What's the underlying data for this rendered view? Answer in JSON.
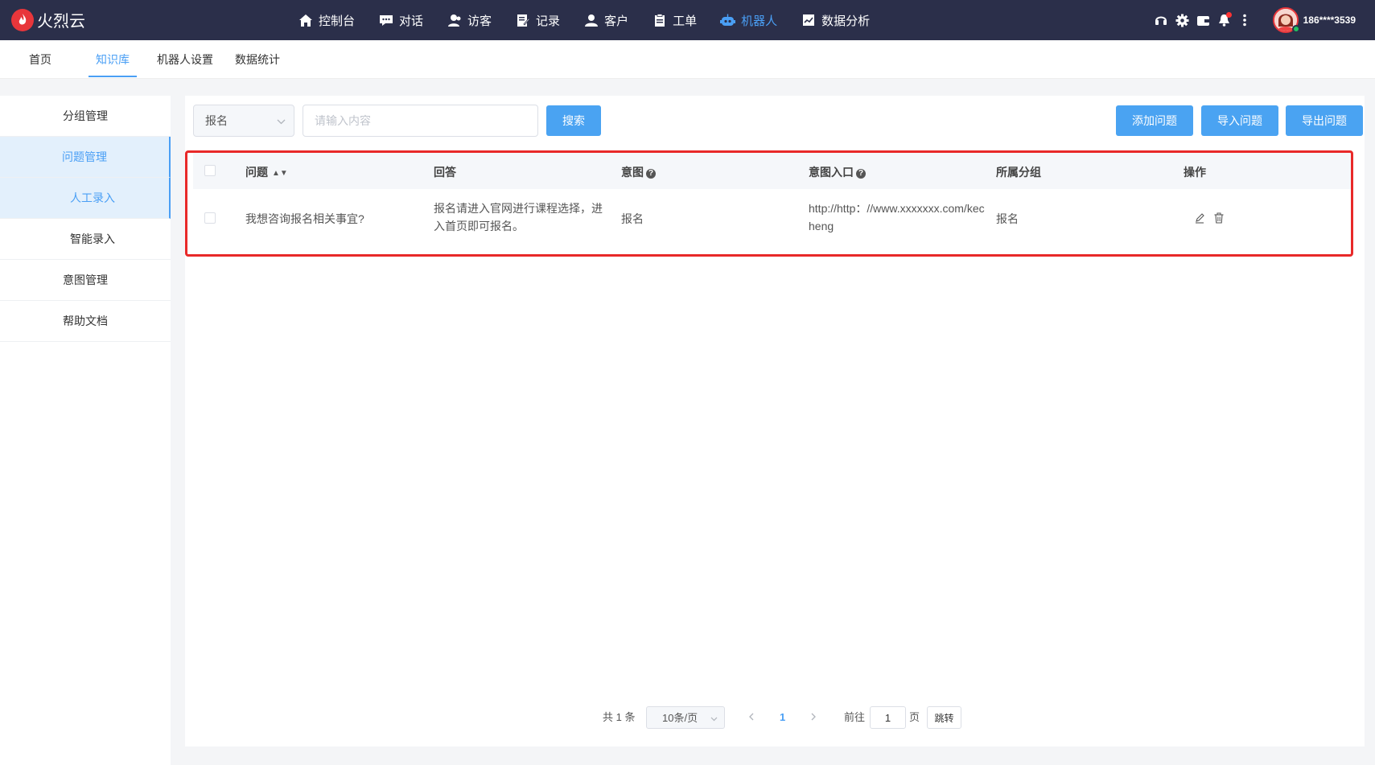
{
  "app": {
    "logo_text": "火烈云",
    "user_name": "186****3539"
  },
  "nav": [
    {
      "label": "控制台",
      "icon": "home-icon"
    },
    {
      "label": "对话",
      "icon": "chat-icon"
    },
    {
      "label": "访客",
      "icon": "visitors-icon"
    },
    {
      "label": "记录",
      "icon": "record-icon"
    },
    {
      "label": "客户",
      "icon": "customer-icon"
    },
    {
      "label": "工单",
      "icon": "ticket-icon"
    },
    {
      "label": "机器人",
      "icon": "robot-icon",
      "active": true
    },
    {
      "label": "数据分析",
      "icon": "analytics-icon"
    }
  ],
  "subtabs": [
    {
      "label": "首页"
    },
    {
      "label": "知识库",
      "active": true
    },
    {
      "label": "机器人设置"
    },
    {
      "label": "数据统计"
    }
  ],
  "sidebar": [
    {
      "label": "分组管理"
    },
    {
      "label": "问题管理",
      "active": true
    },
    {
      "label": "人工录入",
      "active": true
    },
    {
      "label": "智能录入"
    },
    {
      "label": "意图管理"
    },
    {
      "label": "帮助文档"
    }
  ],
  "search": {
    "select_value": "报名",
    "placeholder": "请输入内容",
    "search_button": "搜索"
  },
  "actions": {
    "add": "添加问题",
    "import": "导入问题",
    "export": "导出问题"
  },
  "table": {
    "headers": [
      "问题",
      "回答",
      "意图",
      "意图入口",
      "所属分组",
      "操作"
    ],
    "rows": [
      {
        "question": "我想咨询报名相关事宜?",
        "answer": "报名请进入官网进行课程选择，进入首页即可报名。",
        "intent": "报名",
        "intent_entry": "http://http：//www.xxxxxxx.com/kecheng",
        "group": "报名"
      }
    ]
  },
  "pagination": {
    "total": "共 1 条",
    "page_size": "10条/页",
    "current_page": "1",
    "goto_label": "前往",
    "goto_value": "1",
    "page_suffix": "页",
    "jump": "跳转"
  },
  "colors": {
    "topbar": "#2b2f4a",
    "accent": "#4a9ff5",
    "highlight_frame": "#e82929"
  }
}
